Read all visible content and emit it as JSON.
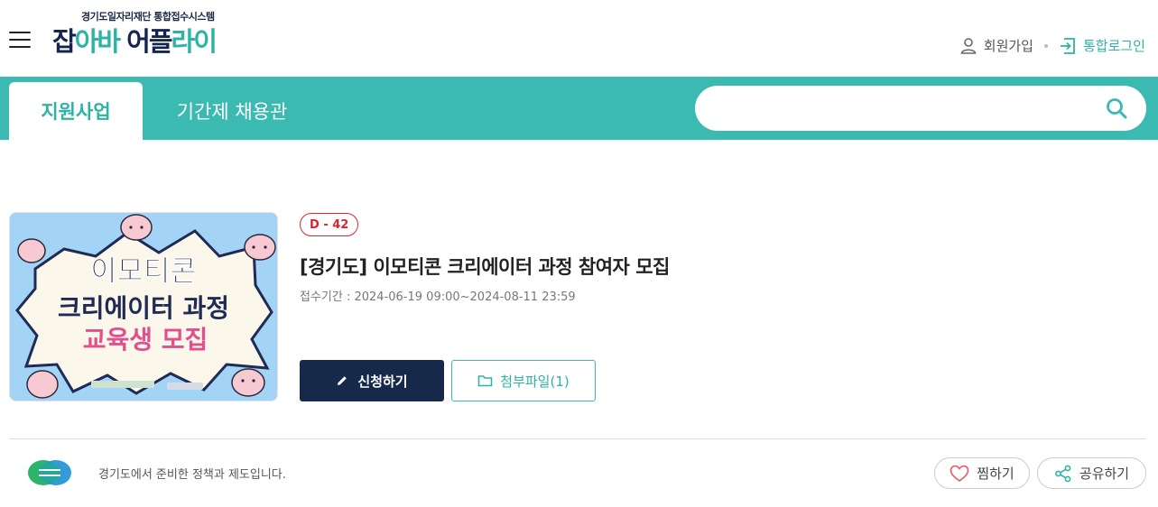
{
  "header": {
    "logo_subtitle": "경기도일자리재단 통합접수시스템",
    "logo_parts": [
      "잡",
      "아바",
      " 어플",
      "라이"
    ],
    "join_label": "회원가입",
    "login_label": "통합로그인"
  },
  "nav": {
    "tabs": [
      {
        "label": "지원사업",
        "active": true
      },
      {
        "label": "기간제 채용관",
        "active": false
      }
    ],
    "search_placeholder": ""
  },
  "program": {
    "dday": "D - 42",
    "title": "[경기도] 이모티콘 크리에이터 과정 참여자 모집",
    "period": "접수기간 : 2024-06-19 09:00~2024-08-11 23:59",
    "thumbnail_lines": [
      "이모티콘",
      "크리에이터 과정",
      "교육생 모집"
    ],
    "apply_label": "신청하기",
    "attachment_label": "첨부파일(1)"
  },
  "footer": {
    "org_text": "경기도에서 준비한 정책과 제도입니다.",
    "like_label": "찜하기",
    "share_label": "공유하기"
  },
  "colors": {
    "teal": "#3bbab2",
    "navy": "#16294a",
    "dday_red": "#d6262f"
  }
}
